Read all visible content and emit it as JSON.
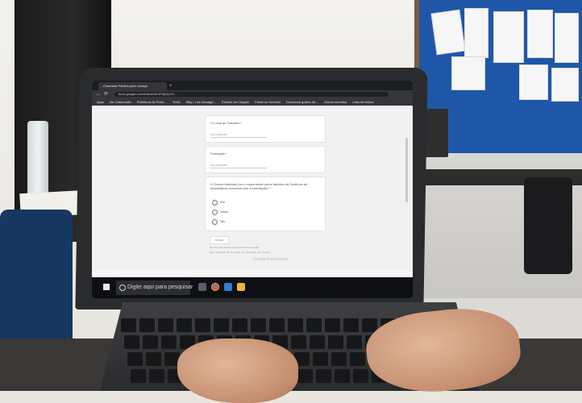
{
  "browser": {
    "tab_title": "Chamada Pública para Locaçã",
    "new_tab": "+",
    "url": "docs.google.com/forms/d/e/1FAIpQLSf...",
    "bookmarks": [
      "Apps",
      "Be Collaborate",
      "Prefeitura de Porto...",
      "Trello",
      "Bitly | Link Manage...",
      "Estúdio de Criação",
      "Portal do Servidor",
      "Download gráfico de...",
      "Outros favoritos",
      "Lista de leitura"
    ]
  },
  "form": {
    "q_local": "O Local de Trabalho *",
    "q_local_placeholder": "Sua resposta",
    "q_formacao": "Formação *",
    "q_formacao_placeholder": "Sua resposta",
    "q_choice": "O Gestor-Imediato (ou o responsável pelos trâmites da Gerência de Informática) concorda com a solicitação? *",
    "options": [
      "Sim",
      "Talvez",
      "Não"
    ],
    "submit": "Enviar",
    "footer1": "Nunca envie senhas pelo Formulários Google.",
    "footer2": "Este conteúdo não foi criado nem aprovado pelo Google.",
    "brand": "Google Formulários"
  },
  "taskbar": {
    "search_placeholder": "Digite aqui para pesquisar",
    "clock_time": "",
    "clock_date": ""
  },
  "colors": {
    "board": "#1f57a8",
    "taskbar": "#0d0f13",
    "laptop": "#2a2b2d"
  }
}
